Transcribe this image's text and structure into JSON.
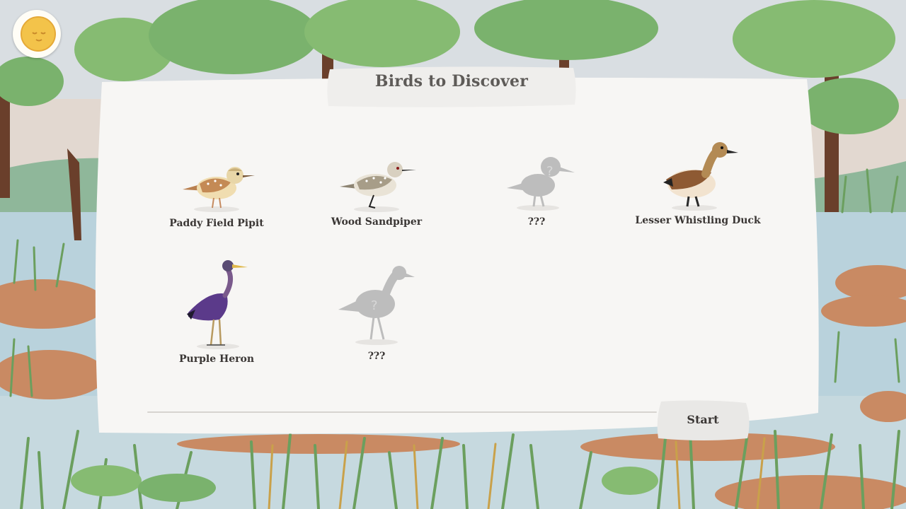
{
  "panel": {
    "title": "Birds to Discover"
  },
  "birds": [
    {
      "label": "Paddy Field Pipit",
      "discovered": true
    },
    {
      "label": "Wood Sandpiper",
      "discovered": true
    },
    {
      "label": "???",
      "discovered": false
    },
    {
      "label": "Lesser Whistling Duck",
      "discovered": true
    },
    {
      "label": "Purple Heron",
      "discovered": true
    },
    {
      "label": "???",
      "discovered": false
    }
  ],
  "actions": {
    "start_label": "Start"
  },
  "icons": {
    "top_left": "sun-moon-icon",
    "hidden_bird": "question-mark-icon"
  },
  "colors": {
    "panel": "#f7f6f4",
    "text": "#3a3634",
    "title": "#5e5b58",
    "silhouette": "#bdbdbd",
    "sun": "#f3c34a"
  }
}
